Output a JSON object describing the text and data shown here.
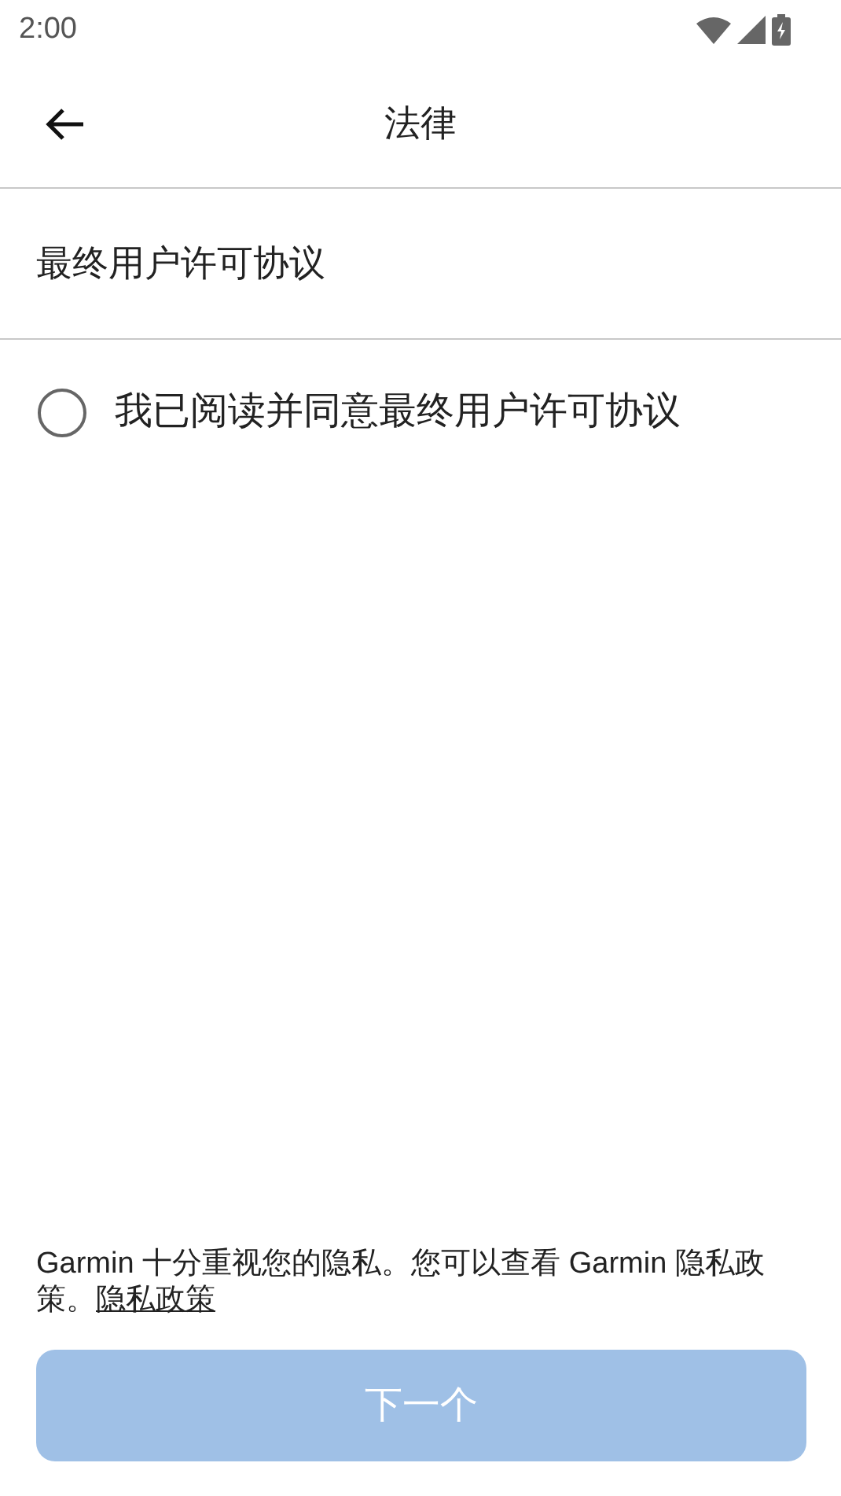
{
  "status_bar": {
    "time": "2:00"
  },
  "toolbar": {
    "title": "法律"
  },
  "document_link": {
    "label": "最终用户许可协议"
  },
  "agreement": {
    "label": "我已阅读并同意最终用户许可协议",
    "checked": false
  },
  "privacy_notice": {
    "text": "Garmin 十分重视您的隐私。您可以查看 Garmin 隐私政策。",
    "link": "隐私政策"
  },
  "next_button": {
    "label": "下一个",
    "disabled": true
  }
}
